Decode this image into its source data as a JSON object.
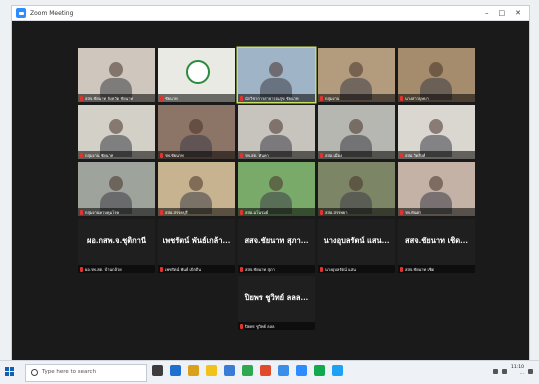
{
  "window": {
    "title": "Zoom Meeting",
    "controls": [
      "–",
      "□",
      "✕"
    ]
  },
  "participants": [
    {
      "name": "สสจ.ชัยนาท จังหวัด ชัยนาท",
      "tile_text": "",
      "type": "video",
      "color": "#cfc7bd"
    },
    {
      "name": "ชัยนาท",
      "tile_text": "",
      "type": "logo",
      "color": "#e8eae3"
    },
    {
      "name": "นักวิชาการสาธารณสุข ชัยนาท",
      "tile_text": "",
      "type": "video",
      "color": "#9fb4c7",
      "active": true
    },
    {
      "name": "กลุ่มงาน",
      "tile_text": "",
      "type": "video",
      "color": "#b39b7e"
    },
    {
      "name": "นางสาวบุษบา",
      "tile_text": "",
      "type": "video",
      "color": "#a58c6c"
    },
    {
      "name": "กลุ่มงาน ชัยนาท",
      "tile_text": "",
      "type": "video",
      "color": "#d3d0c8"
    },
    {
      "name": "รพ.ชัยนาท",
      "tile_text": "",
      "type": "video",
      "color": "#8c7466"
    },
    {
      "name": "รพ.สต. หันคา",
      "tile_text": "",
      "type": "video",
      "color": "#c7c4bd"
    },
    {
      "name": "สสอ.เมือง",
      "tile_text": "",
      "type": "video",
      "color": "#b5b7b0"
    },
    {
      "name": "สสอ.วัดสิงห์",
      "tile_text": "",
      "type": "video",
      "color": "#dad7d1"
    },
    {
      "name": "กลุ่มงานควบคุมโรค",
      "tile_text": "",
      "type": "video",
      "color": "#9ea39b"
    },
    {
      "name": "สสอ.สรรคบุรี",
      "tile_text": "",
      "type": "video",
      "color": "#c8b391"
    },
    {
      "name": "สสอ.มโนรมย์",
      "tile_text": "",
      "type": "video",
      "color": "#7aaa6a"
    },
    {
      "name": "สสอ.สรรพยา",
      "tile_text": "",
      "type": "video",
      "color": "#7d8567"
    },
    {
      "name": "รพ.หันคา",
      "tile_text": "",
      "type": "video",
      "color": "#c4b2a6"
    },
    {
      "name": "ผอ.รพ.สต. บ้านกล้วย",
      "tile_text": "ผอ.กสพ.จ.ชุติกานี",
      "type": "name"
    },
    {
      "name": "เพชรัตน์ พันธ์ เบิกถิ่น",
      "tile_text": "เพชรัตน์ พันธ์เกล้า...",
      "type": "name"
    },
    {
      "name": "สสจ.ชัยนาท สุภา",
      "tile_text": "สสจ.ชัยนาท สุภา...",
      "type": "name"
    },
    {
      "name": "นางอุบลรัตน์ แสน",
      "tile_text": "นางอุบลรัตน์ แสน...",
      "type": "name"
    },
    {
      "name": "สสจ.ชัยนาท เชิด",
      "tile_text": "สสจ.ชัยนาท เชิด...",
      "type": "name"
    },
    {
      "name": "ปิยพร ชูวิทย์ ลลล",
      "tile_text": "ปิยพร ชูวิทย์ ลลล...",
      "type": "name"
    }
  ],
  "taskbar": {
    "search_placeholder": "Type here to search",
    "time": "11:10",
    "date": "...",
    "pinned_colors": [
      "#3c3c3c",
      "#1f6fd1",
      "#d9a01b",
      "#f0c21b",
      "#3a7bd5",
      "#2fa84f",
      "#e04b2c",
      "#3b8ee8",
      "#2d8cff",
      "#11a84e",
      "#1da1f2"
    ]
  }
}
